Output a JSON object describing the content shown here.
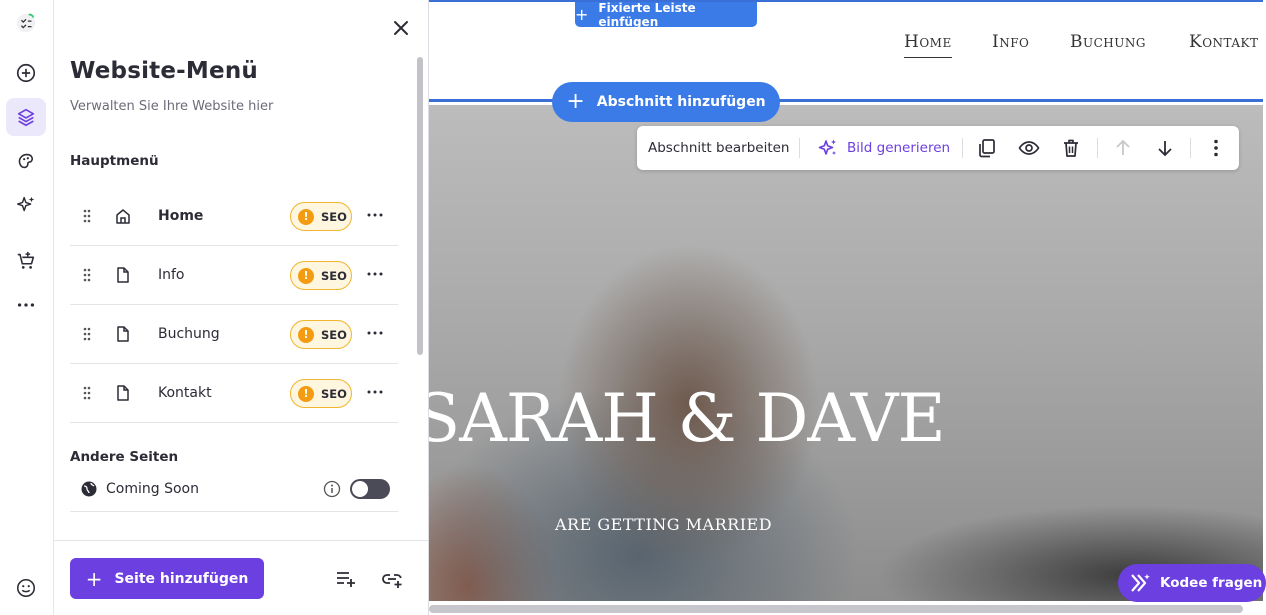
{
  "rail": {
    "items": [
      {
        "name": "checklist",
        "active": false
      },
      {
        "name": "add",
        "active": false
      },
      {
        "name": "layers",
        "active": true
      },
      {
        "name": "styles",
        "active": false
      },
      {
        "name": "ai-tools",
        "active": false
      },
      {
        "name": "store",
        "active": false
      },
      {
        "name": "more",
        "active": false
      },
      {
        "name": "help",
        "active": false
      }
    ]
  },
  "panel": {
    "title": "Website-Menü",
    "subtitle": "Verwalten Sie Ihre Website hier",
    "main_menu_heading": "Hauptmenü",
    "main_menu": [
      {
        "label": "Home",
        "icon": "home-icon",
        "badge": "SEO",
        "bold": true
      },
      {
        "label": "Info",
        "icon": "page-icon",
        "badge": "SEO",
        "bold": false
      },
      {
        "label": "Buchung",
        "icon": "page-icon",
        "badge": "SEO",
        "bold": false
      },
      {
        "label": "Kontakt",
        "icon": "page-icon",
        "badge": "SEO",
        "bold": false
      }
    ],
    "other_pages_heading": "Andere Seiten",
    "other_pages": [
      {
        "label": "Coming Soon",
        "icon": "globe-icon",
        "toggle_on": false
      }
    ],
    "add_page_label": "Seite hinzufügen",
    "warning_glyph": "!"
  },
  "canvas": {
    "fixed_bar_label": "Fixierte Leiste einfügen",
    "add_section_label": "Abschnitt hinzufügen",
    "nav": [
      "Home",
      "Info",
      "Buchung",
      "Kontakt"
    ],
    "nav_active": "Home",
    "toolbar": {
      "edit_section_label": "Abschnitt bearbeiten",
      "generate_image_label": "Bild generieren"
    },
    "hero": {
      "title": "SARAH & DAVE",
      "subtitle": "ARE GETTING MARRIED"
    }
  },
  "kodee": {
    "label": "Kodee fragen"
  },
  "colors": {
    "accent_purple": "#6c3fe0",
    "accent_blue": "#3b7be8",
    "seo_warning": "#f39c12"
  }
}
